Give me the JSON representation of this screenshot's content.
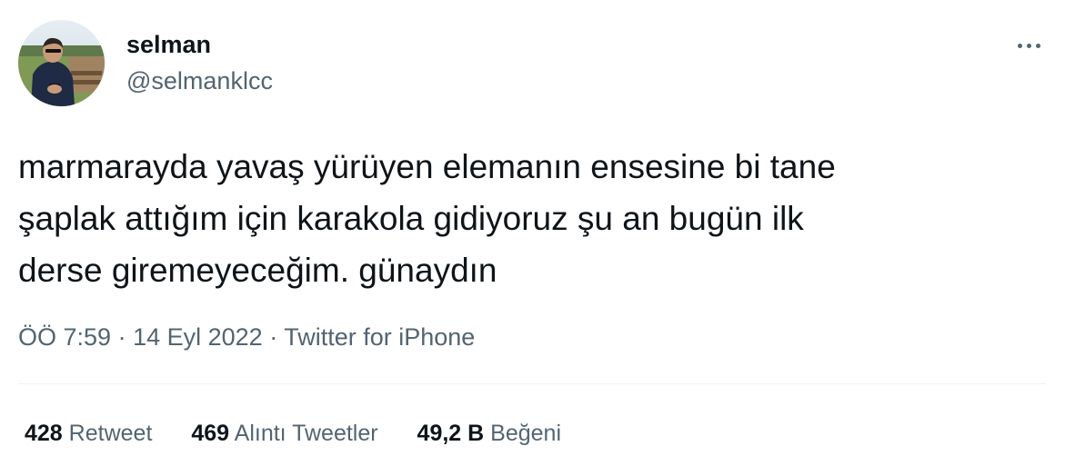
{
  "user": {
    "display_name": "selman",
    "handle": "@selmanklcc",
    "avatar_icon": "profile-photo"
  },
  "menu": {
    "more_icon": "more-horizontal-icon"
  },
  "tweet": {
    "text": "marmarayda yavaş yürüyen elemanın ensesine bi tane\nşaplak attığım için karakola gidiyoruz şu an bugün ilk\nderse giremeyeceğim. günaydın"
  },
  "meta": {
    "time": "ÖÖ 7:59",
    "separator": "·",
    "date": "14 Eyl 2022",
    "source": "Twitter for iPhone"
  },
  "stats": {
    "retweets_count": "428",
    "retweets_label": "Retweet",
    "quotes_count": "469",
    "quotes_label": "Alıntı Tweetler",
    "likes_count": "49,2 B",
    "likes_label": "Beğeni"
  },
  "colors": {
    "primary_text": "#0f1419",
    "secondary_text": "#536471",
    "divider": "#eff3f4"
  }
}
